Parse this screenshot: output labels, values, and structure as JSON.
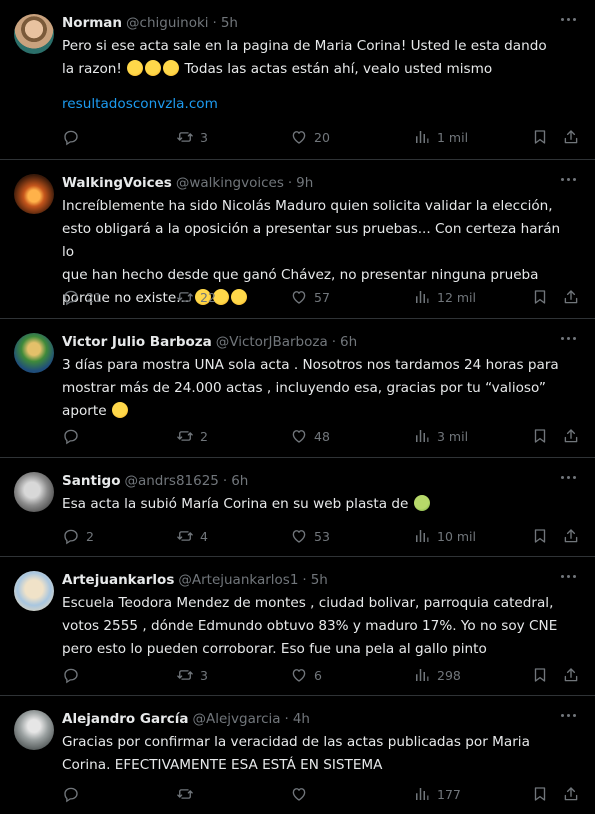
{
  "tweets": [
    {
      "name": "Norman",
      "handle": "@chiguinoki",
      "time": "5h",
      "text": "Pero si ese acta sale en la pagina de Maria Corina! Usted le esta dando la razon!",
      "text_tail": "Todas las actas están ahí, vealo usted mismo",
      "emoji_count": 3,
      "link": "resultadosconvzla.com",
      "reply": "",
      "retweet": "3",
      "like": "20",
      "views": "1 mil"
    },
    {
      "name": "WalkingVoices",
      "handle": "@walkingvoices",
      "time": "9h",
      "text": "Increíblemente ha sido Nicolás Maduro quien solicita validar la elección,\nesto obligará a la oposición a presentar sus pruebas... Con certeza harán lo\nque han hecho desde que ganó Chávez, no presentar ninguna prueba\nporque no existe...",
      "emoji_count": 3,
      "reply": "21",
      "retweet": "22",
      "like": "57",
      "views": "12 mil"
    },
    {
      "name": "Victor Julio Barboza",
      "handle": "@VictorJBarboza",
      "time": "6h",
      "text": "3 días para mostra UNA sola acta . Nosotros nos tardamos 24 horas para\nmostrar más de 24.000 actas , incluyendo esa, gracias por tu “valioso”\naporte",
      "emoji_count": 1,
      "reply": "",
      "retweet": "2",
      "like": "48",
      "views": "3 mil"
    },
    {
      "name": "Santigo",
      "handle": "@andrs81625",
      "time": "6h",
      "text": "Esa acta la subió María Corina en su web plasta de",
      "emoji_count": 1,
      "reply": "2",
      "retweet": "4",
      "like": "53",
      "views": "10 mil"
    },
    {
      "name": "Artejuankarlos",
      "handle": "@Artejuankarlos1",
      "time": "5h",
      "text": "Escuela Teodora Mendez de montes , ciudad bolivar, parroquia catedral,\nvotos 2555 , dónde Edmundo obtuvo 83% y maduro 17%. Yo no soy CNE\npero esto lo pueden corroborar. Eso fue una pela al gallo pinto",
      "emoji_count": 0,
      "reply": "",
      "retweet": "3",
      "like": "6",
      "views": "298"
    },
    {
      "name": "Alejandro García",
      "handle": "@Alejvgarcia",
      "time": "4h",
      "text": "Gracias por confirmar la veracidad de las actas publicadas por Maria\nCorina. EFECTIVAMENTE ESA ESTÁ EN SISTEMA",
      "emoji_count": 0,
      "reply": "",
      "retweet": "",
      "like": "",
      "views": "177"
    }
  ],
  "separator": "·",
  "colors": {
    "background": "#000000",
    "text": "#e7e9ea",
    "muted": "#71767b",
    "link": "#1d9bf0",
    "divider": "#2f3336"
  }
}
